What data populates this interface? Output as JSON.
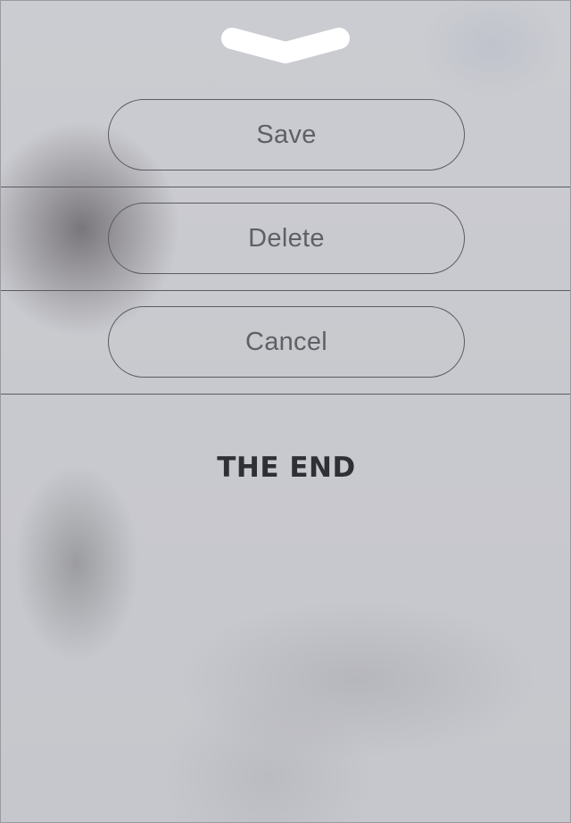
{
  "sheet": {
    "dismiss_icon": "chevron-down-icon",
    "actions": [
      {
        "id": "save",
        "label": "Save"
      },
      {
        "id": "delete",
        "label": "Delete"
      },
      {
        "id": "cancel",
        "label": "Cancel"
      }
    ]
  },
  "content": {
    "title": "THE END"
  },
  "colors": {
    "background": "#c9cacf",
    "button_border": "#5b5c61",
    "button_text": "#5f6065",
    "title_text": "#2f3035",
    "chevron": "#ffffff"
  }
}
